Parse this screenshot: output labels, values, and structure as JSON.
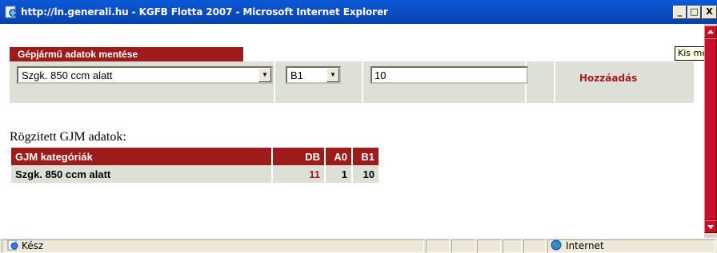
{
  "window": {
    "title": "http://ln.generali.hu - KGFB Flotta 2007 - Microsoft Internet Explorer",
    "minimize_label": "_",
    "maximize_label": "□",
    "close_label": "X"
  },
  "form": {
    "section_title": "Gépjármű adatok mentése",
    "category_select": {
      "selected": "Szgk. 850 ccm alatt"
    },
    "class_select": {
      "selected": "B1"
    },
    "quantity_input": {
      "value": "10"
    },
    "add_label": "Hozzáadás"
  },
  "tooltip": {
    "text": "Kis méret"
  },
  "saved": {
    "heading": "Rögzitett GJM adatok:",
    "columns": [
      "GJM kategóriák",
      "DB",
      "A0",
      "B1"
    ],
    "rows": [
      {
        "category": "Szgk. 850 ccm alatt",
        "db": "11",
        "a0": "1",
        "b1": "10"
      }
    ]
  },
  "status": {
    "text": "Kész",
    "zone": "Internet"
  },
  "colors": {
    "accent": "#9e1b1b",
    "cell_bg": "#dde0d6",
    "scrollbar": "#c8102e"
  },
  "icons": {
    "app": "ie-page-icon",
    "status": "ie-page-icon",
    "zone": "globe-icon"
  }
}
